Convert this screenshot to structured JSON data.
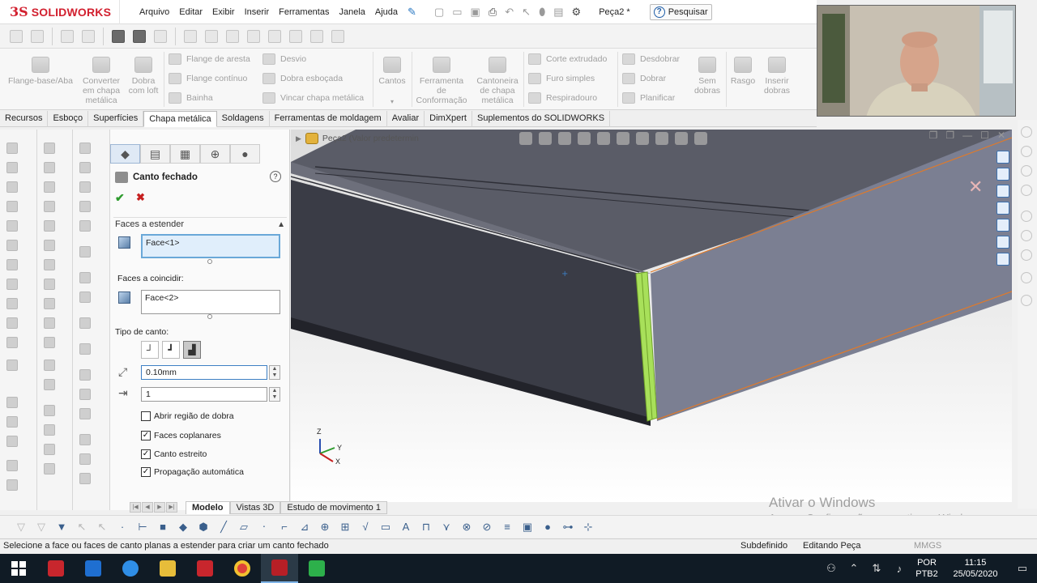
{
  "app": {
    "brand": "SOLIDWORKS",
    "logo_mark": "3S",
    "menus": [
      "Arquivo",
      "Editar",
      "Exibir",
      "Inserir",
      "Ferramentas",
      "Janela",
      "Ajuda"
    ],
    "doc_title": "Peça2 *",
    "search_label": "Pesquisar"
  },
  "ribbon": {
    "big_buttons": [
      {
        "label": "Flange-base/Aba",
        "icon": "base-flange-icon"
      },
      {
        "label": "Converter em chapa metálica",
        "icon": "convert-sheet-icon"
      },
      {
        "label": "Dobra com loft",
        "icon": "lofted-bend-icon"
      },
      {
        "label": "Cantos",
        "icon": "corners-icon"
      },
      {
        "label": "Ferramenta de Conformação",
        "icon": "forming-tool-icon"
      },
      {
        "label": "Cantoneira de chapa metálica",
        "icon": "gusset-icon"
      },
      {
        "label": "Sem dobras",
        "icon": "no-bends-icon"
      },
      {
        "label": "Rasgo",
        "icon": "rip-icon"
      },
      {
        "label": "Inserir dobras",
        "icon": "insert-bends-icon"
      }
    ],
    "small_buttons": [
      {
        "label": "Flange de aresta",
        "icon": "edge-flange-icon"
      },
      {
        "label": "Flange contínuo",
        "icon": "miter-flange-icon"
      },
      {
        "label": "Bainha",
        "icon": "hem-icon"
      },
      {
        "label": "Desvio",
        "icon": "jog-icon"
      },
      {
        "label": "Dobra esboçada",
        "icon": "sketched-bend-icon"
      },
      {
        "label": "Vincar chapa metálica",
        "icon": "cross-break-icon"
      },
      {
        "label": "Corte extrudado",
        "icon": "extruded-cut-icon"
      },
      {
        "label": "Furo simples",
        "icon": "simple-hole-icon"
      },
      {
        "label": "Respiradouro",
        "icon": "vent-icon"
      },
      {
        "label": "Desdobrar",
        "icon": "unfold-icon"
      },
      {
        "label": "Dobrar",
        "icon": "fold-icon"
      },
      {
        "label": "Planificar",
        "icon": "flatten-icon"
      }
    ]
  },
  "tabs": [
    "Recursos",
    "Esboço",
    "Superfícies",
    "Chapa metálica",
    "Soldagens",
    "Ferramentas de moldagem",
    "Avaliar",
    "DimXpert",
    "Suplementos do SOLIDWORKS"
  ],
  "active_tab": "Chapa metálica",
  "property_manager": {
    "title": "Canto fechado",
    "ok_symbol": "✔",
    "cancel_symbol": "✖",
    "help_symbol": "?",
    "faces_extend_label": "Faces a estender",
    "faces_extend_value": "Face<1>",
    "faces_match_label": "Faces a coincidir:",
    "faces_match_value": "Face<2>",
    "corner_type_label": "Tipo de canto:",
    "gap_value": "0.10mm",
    "overlap_value": "1",
    "checkboxes": [
      {
        "label": "Abrir região de dobra",
        "checked": false
      },
      {
        "label": "Faces coplanares",
        "checked": true
      },
      {
        "label": "Canto estreito",
        "checked": true
      },
      {
        "label": "Propagação automática",
        "checked": true
      }
    ]
  },
  "graphics": {
    "breadcrumb": "Peça2  (Valor predetermin",
    "triad_z": "Z",
    "triad_y": "Y",
    "triad_x": "X"
  },
  "watermark": {
    "line1": "Ativar o Windows",
    "line2": "Acesse Configurações para ativar o Windows."
  },
  "model_tabs": [
    "Modelo",
    "Vistas 3D",
    "Estudo de movimento 1"
  ],
  "status": {
    "message": "Selecione a face ou faces de canto planas a estender para criar um canto fechado",
    "s1": "Subdefinido",
    "s2": "Editando Peça",
    "s3": "MMGS"
  },
  "taskbar": {
    "lang1": "POR",
    "lang2": "PTB2",
    "time": "11:15",
    "date": "25/05/2020"
  },
  "colors": {
    "accent_red": "#d2202f",
    "part_gray": "#7b7f92",
    "highlight_green": "#a8e05a",
    "edge_orange": "#e07a2a"
  }
}
